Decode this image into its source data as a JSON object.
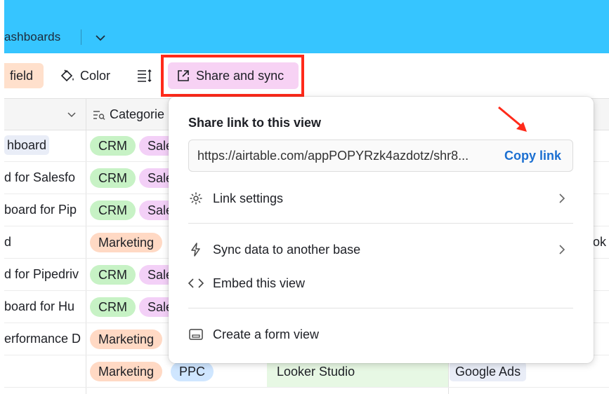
{
  "topbar": {
    "tab_label": "ashboards"
  },
  "toolbar": {
    "field_label": "field",
    "color_label": "Color",
    "share_label": "Share and sync"
  },
  "grid": {
    "header_categories": "Categorie",
    "header_last": "ok",
    "rows": [
      {
        "name": "hboard",
        "tags": [
          "CRM",
          "Sale"
        ]
      },
      {
        "name": "d for Salesfo",
        "tags": [
          "CRM",
          "Sale"
        ]
      },
      {
        "name": "board for Pip",
        "tags": [
          "CRM",
          "Sale"
        ]
      },
      {
        "name": "d",
        "tags": [
          "Marketing"
        ]
      },
      {
        "name": "d for Pipedriv",
        "tags": [
          "CRM",
          "Sale"
        ]
      },
      {
        "name": "board for Hu",
        "tags": [
          "CRM",
          "Sale"
        ]
      },
      {
        "name": "erformance D",
        "tags": [
          "Marketing"
        ]
      },
      {
        "name": "",
        "tags": [
          "Marketing",
          "PPC"
        ],
        "tool": "Looker Studio",
        "source": "Google Ads"
      }
    ]
  },
  "popup": {
    "title": "Share link to this view",
    "url": "https://airtable.com/appPOPYRzk4azdotz/shr8...",
    "copy_label": "Copy link",
    "link_settings": "Link settings",
    "sync_label": "Sync data to another base",
    "embed_label": "Embed this view",
    "form_label": "Create a form view"
  },
  "colors": {
    "topbar": "#36c5ff",
    "share_bg": "#f7d2f4",
    "highlight": "#ff2a1a",
    "link": "#1b6fd1"
  }
}
